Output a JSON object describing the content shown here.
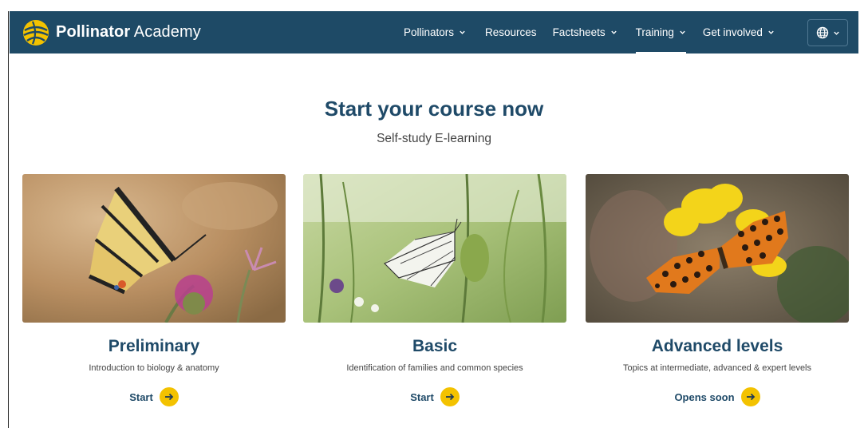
{
  "brand": {
    "name_bold": "Pollinator",
    "name_light": "Academy"
  },
  "nav": {
    "items": [
      {
        "label": "Pollinators",
        "has_dropdown": true
      },
      {
        "label": "Resources",
        "has_dropdown": false
      },
      {
        "label": "Factsheets",
        "has_dropdown": true
      },
      {
        "label": "Training",
        "has_dropdown": true,
        "active": true
      },
      {
        "label": "Get involved",
        "has_dropdown": true
      }
    ],
    "language_icon": "globe-icon"
  },
  "hero": {
    "title": "Start your course now",
    "subtitle": "Self-study E-learning"
  },
  "courses": [
    {
      "title": "Preliminary",
      "description": "Introduction to biology & anatomy",
      "cta": "Start",
      "image": "swallowtail-butterfly-on-thistle"
    },
    {
      "title": "Basic",
      "description": "Identification of families and common species",
      "cta": "Start",
      "image": "white-butterfly-in-grass"
    },
    {
      "title": "Advanced levels",
      "description": "Topics at intermediate, advanced & expert levels",
      "cta": "Opens soon",
      "image": "fritillary-butterfly-on-yellow-flower"
    }
  ],
  "colors": {
    "nav_bg": "#1e4a66",
    "accent": "#f3c200",
    "heading": "#1f4a68"
  }
}
